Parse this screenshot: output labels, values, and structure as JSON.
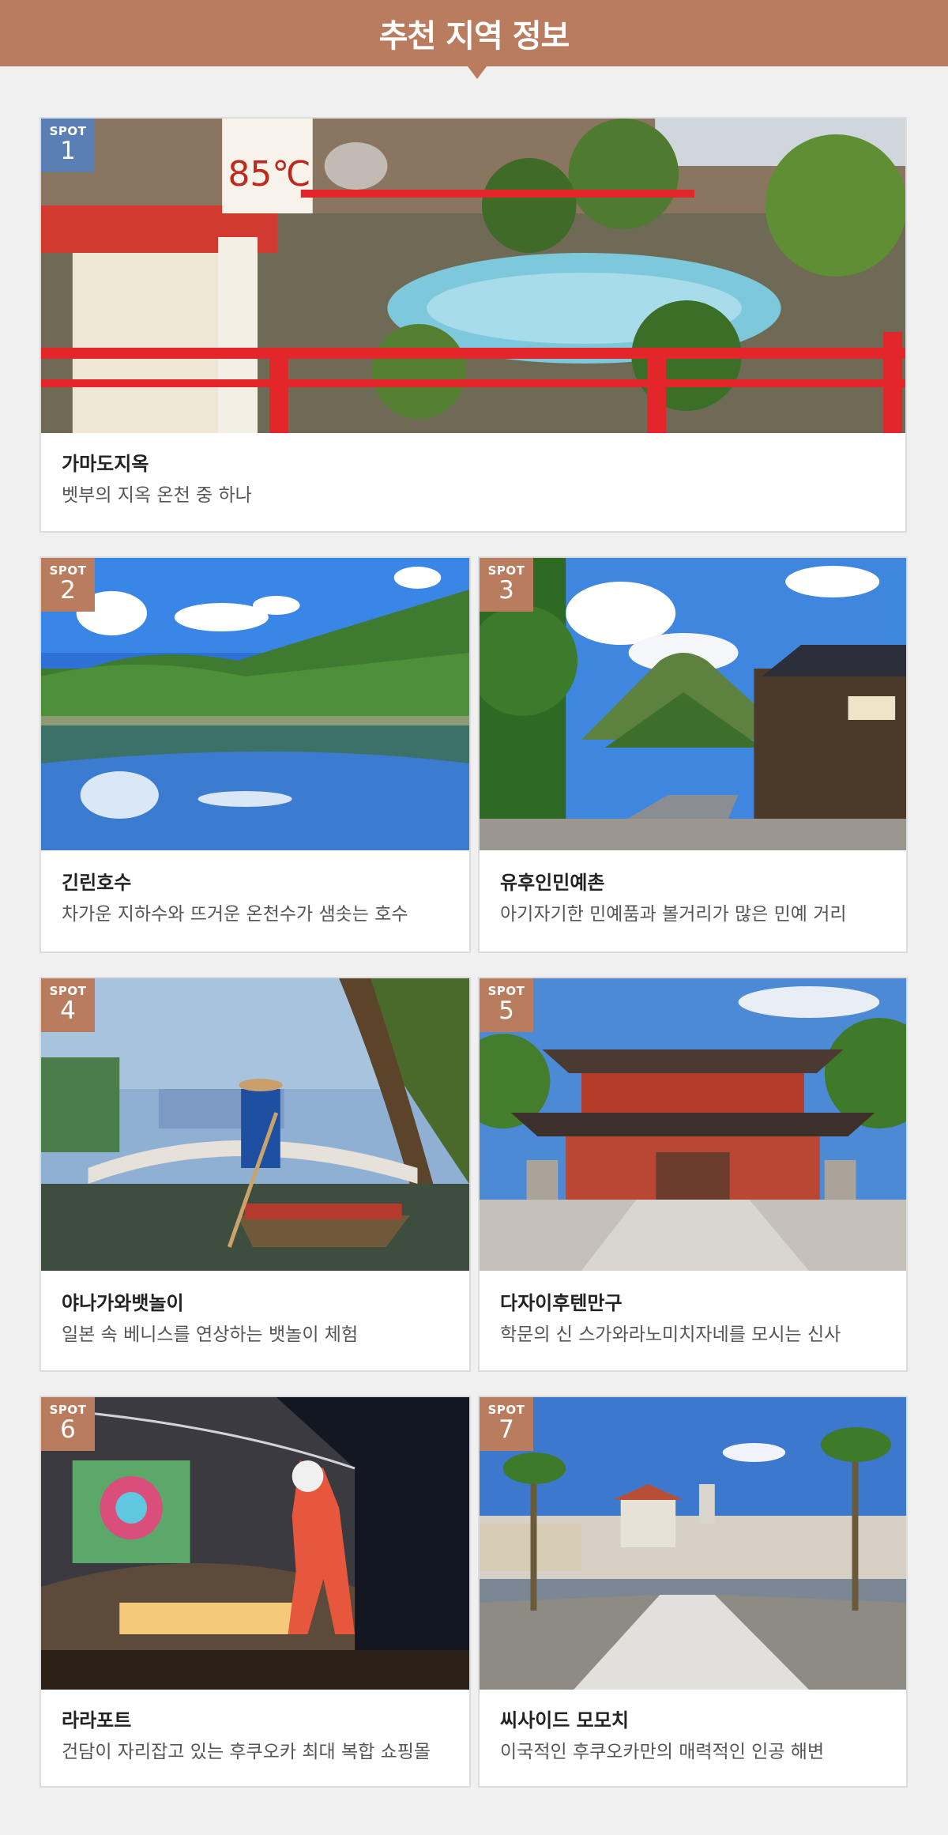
{
  "header": {
    "title": "추천 지역 정보"
  },
  "spots": [
    {
      "badge_label": "SPOT",
      "number": "1",
      "name": "가마도지옥",
      "desc": "벳부의 지옥 온천 중 하나"
    },
    {
      "badge_label": "SPOT",
      "number": "2",
      "name": "긴린호수",
      "desc": "차가운 지하수와 뜨거운 온천수가 샘솟는 호수"
    },
    {
      "badge_label": "SPOT",
      "number": "3",
      "name": "유후인민예촌",
      "desc": "아기자기한 민예품과 볼거리가 많은 민예 거리"
    },
    {
      "badge_label": "SPOT",
      "number": "4",
      "name": "야나가와뱃놀이",
      "desc": "일본 속 베니스를 연상하는 뱃놀이 체험"
    },
    {
      "badge_label": "SPOT",
      "number": "5",
      "name": "다자이후텐만구",
      "desc": "학문의 신 스가와라노미치자네를 모시는 신사"
    },
    {
      "badge_label": "SPOT",
      "number": "6",
      "name": "라라포트",
      "desc": "건담이 자리잡고 있는 후쿠오카 최대 복합 쇼핑몰"
    },
    {
      "badge_label": "SPOT",
      "number": "7",
      "name": "씨사이드 모모치",
      "desc": "이국적인 후쿠오카만의 매력적인 인공 해변"
    }
  ],
  "colors": {
    "header_bg": "#b97c5e",
    "badge_spot1": "#5b7fb5",
    "badge_other": "#b97c5e"
  }
}
